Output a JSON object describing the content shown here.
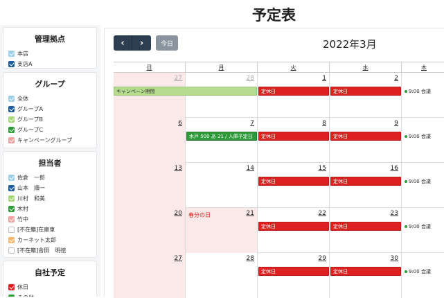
{
  "page_title": "予定表",
  "sidebar": {
    "bases": {
      "title": "管理拠点",
      "items": [
        {
          "label": "本店",
          "checked": true,
          "color": "#9ecfe8"
        },
        {
          "label": "支店A",
          "checked": true,
          "color": "#1f5d9e"
        }
      ]
    },
    "groups": {
      "title": "グループ",
      "items": [
        {
          "label": "全体",
          "checked": true,
          "color": "#9ecfe8"
        },
        {
          "label": "グループA",
          "checked": true,
          "color": "#1f5d9e"
        },
        {
          "label": "グループB",
          "checked": true,
          "color": "#a8d878"
        },
        {
          "label": "グループC",
          "checked": true,
          "color": "#2e9a3a"
        },
        {
          "label": "キャンペーングループ",
          "checked": true,
          "color": "#f2a0a0"
        }
      ]
    },
    "staff": {
      "title": "担当者",
      "items": [
        {
          "label": "佐倉　一郎",
          "checked": true,
          "color": "#9ecfe8"
        },
        {
          "label": "山本　順一",
          "checked": true,
          "color": "#1f5d9e"
        },
        {
          "label": "川村　和美",
          "checked": true,
          "color": "#a8d878"
        },
        {
          "label": "木村",
          "checked": true,
          "color": "#2e9a3a"
        },
        {
          "label": "竹中",
          "checked": true,
          "color": "#f2a0a0"
        },
        {
          "label": "[不在籍]在庫車",
          "checked": false,
          "color": "#ffffff"
        },
        {
          "label": "カーネット太郎",
          "checked": true,
          "color": "#f5b56a"
        },
        {
          "label": "[不在籍]舎田　明徳",
          "checked": false,
          "color": "#ffffff"
        }
      ]
    },
    "company": {
      "title": "自社予定",
      "items": [
        {
          "label": "休日",
          "checked": true,
          "color": "#dd2020"
        },
        {
          "label": "その他",
          "checked": true,
          "color": "#2e9a3a"
        }
      ]
    }
  },
  "toolbar": {
    "prev_label": "‹",
    "next_label": "›",
    "today_label": "今日",
    "month_title": "2022年3月"
  },
  "calendar": {
    "weekdays": [
      "日",
      "月",
      "火",
      "水",
      "木"
    ],
    "weeks": [
      {
        "days": [
          {
            "num": "27",
            "other": true
          },
          {
            "num": "28",
            "other": true
          },
          {
            "num": "1"
          },
          {
            "num": "2"
          },
          {
            "num": ""
          }
        ]
      },
      {
        "days": [
          {
            "num": "6"
          },
          {
            "num": "7"
          },
          {
            "num": "8"
          },
          {
            "num": "9"
          },
          {
            "num": ""
          }
        ]
      },
      {
        "days": [
          {
            "num": "13"
          },
          {
            "num": "14"
          },
          {
            "num": "15"
          },
          {
            "num": "16"
          },
          {
            "num": ""
          }
        ]
      },
      {
        "days": [
          {
            "num": "20"
          },
          {
            "num": "21"
          },
          {
            "num": "22"
          },
          {
            "num": "23"
          },
          {
            "num": ""
          }
        ]
      },
      {
        "days": [
          {
            "num": "27"
          },
          {
            "num": "28"
          },
          {
            "num": "29"
          },
          {
            "num": "30"
          },
          {
            "num": ""
          }
        ]
      }
    ],
    "events": {
      "campaign": "キャンペーン期間",
      "closed": "定休日",
      "arrival": "水戸 500 あ 21 / 入庫予定日",
      "spring_holiday": "春分の日",
      "meeting": "9:00 会議"
    }
  }
}
